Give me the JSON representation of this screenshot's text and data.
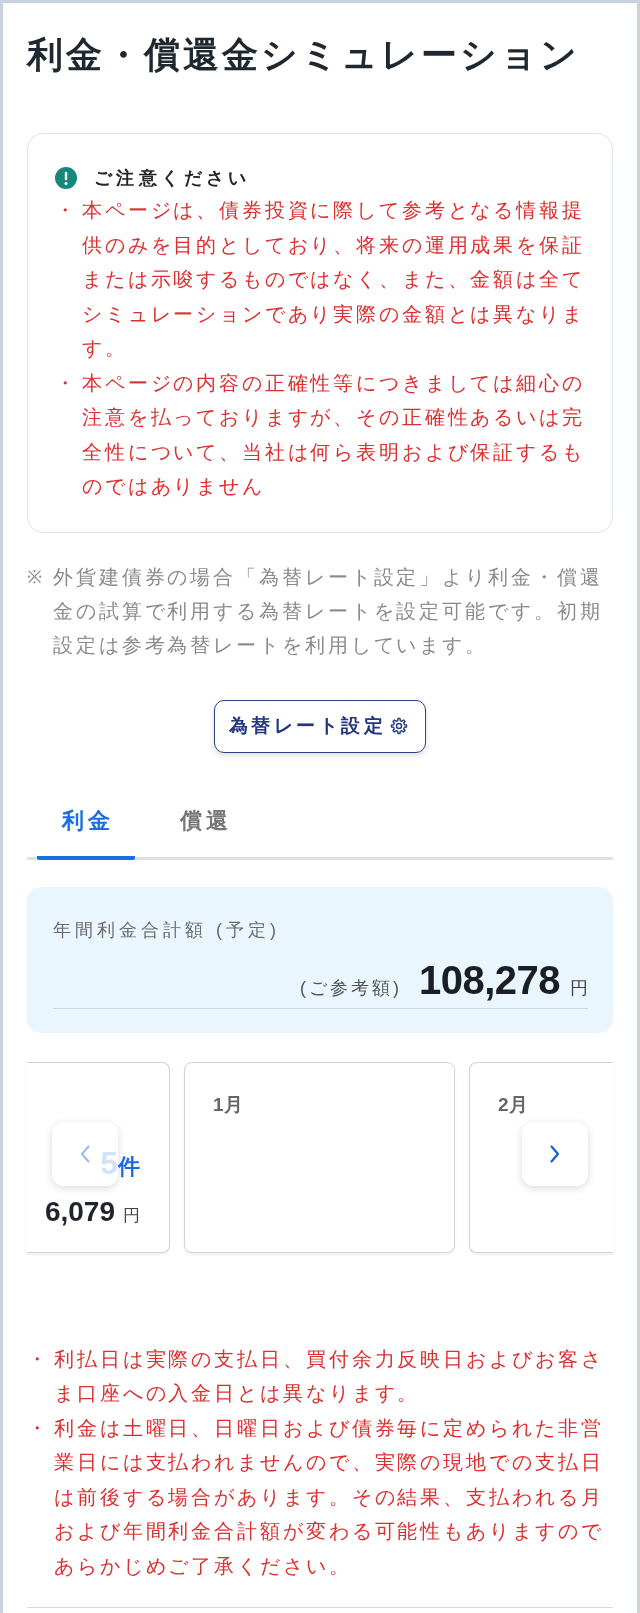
{
  "title": "利金・償還金シミュレーション",
  "notice": {
    "heading": "ご注意ください",
    "items": [
      {
        "bullet": "・",
        "text": "本ページは、債券投資に際して参考となる情報提供のみを目的としており、将来の運用成果を保証または示唆するものではなく、また、金額は全てシミュレーションであり実際の金額とは異なります。"
      },
      {
        "bullet": "・",
        "text": "本ページの内容の正確性等につきましては細心の注意を払っておりますが、その正確性あるいは完全性について、当社は何ら表明および保証するものではありません"
      }
    ]
  },
  "note": {
    "mark": "※",
    "text": "外貨建債券の場合「為替レート設定」より利金・償還金の試算で利用する為替レートを設定可能です。初期設定は参考為替レートを利用しています。"
  },
  "rate_button": {
    "label": "為替レート設定"
  },
  "tabs": [
    {
      "label": "利金",
      "selected": true
    },
    {
      "label": "償還",
      "selected": false
    }
  ],
  "summary": {
    "label": "年間利金合計額 (予定)",
    "reference_label": "(ご参考額)",
    "amount": "108,278",
    "unit": "円"
  },
  "carousel": {
    "prev": {
      "disabled": true
    },
    "next": {
      "disabled": false
    },
    "cards": [
      {
        "count": "5",
        "count_unit": "件",
        "amount": "6,079",
        "unit": "円"
      },
      {
        "month": "1月"
      },
      {
        "month": "2月"
      }
    ]
  },
  "footnotes": [
    {
      "bullet": "・",
      "text": "利払日は実際の支払日、買付余力反映日およびお客さま口座への入金日とは異なります。"
    },
    {
      "bullet": "・",
      "text": "利金は土曜日、日曜日および債券毎に定められた非営業日には支払われませんので、実際の現地での支払日は前後する場合があります。その結果、支払われる月および年間利金合計額が変わる可能性もありますのであらかじめご了承ください。"
    }
  ]
}
